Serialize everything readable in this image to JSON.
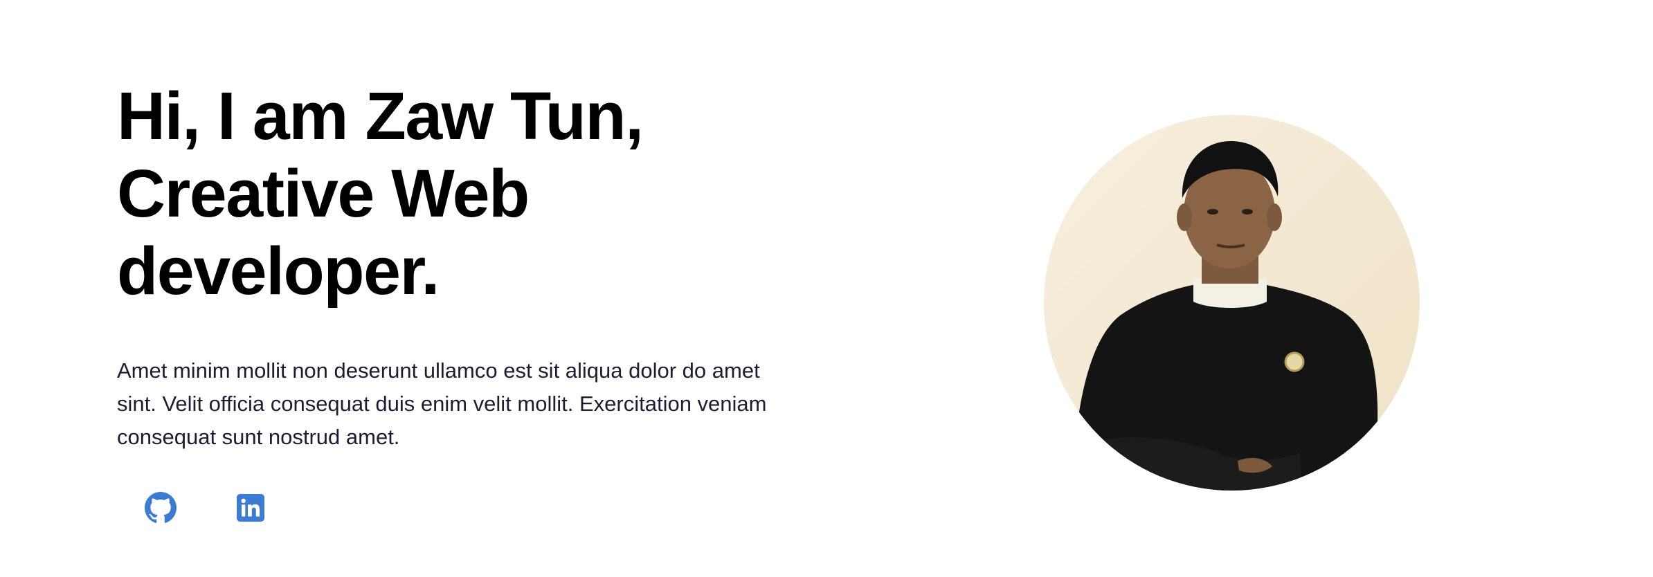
{
  "hero": {
    "headline_lines": [
      "Hi, I am Zaw Tun,",
      "Creative Web",
      "developer."
    ],
    "intro_lines": [
      "Amet minim mollit non deserunt ullamco est sit aliqua dolor do amet",
      "sint. Velit officia consequat duis enim velit mollit. Exercitation veniam",
      "consequat sunt nostrud amet."
    ]
  },
  "socials": [
    {
      "icon": "github-icon",
      "color": "#3b7bd4"
    },
    {
      "icon": "linkedin-icon",
      "color": "#3b7bd4"
    }
  ],
  "portrait": {
    "icon": "profile-photo",
    "colors": {
      "background": "#f4ead8",
      "shirt": "#141414",
      "skin": "#8a6444",
      "collar": "#f3f0e6",
      "badge": "#e6d7a6"
    }
  }
}
